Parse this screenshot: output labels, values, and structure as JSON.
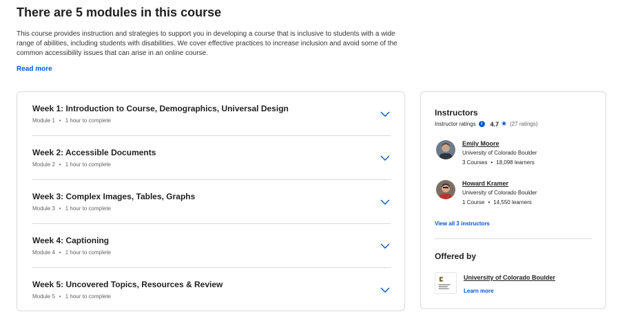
{
  "page": {
    "heading": "There are 5 modules in this course",
    "description": "This course provides instruction and strategies to support you in developing a course that is inclusive to students with a wide range of abilities, including students with disabilities. We cover effective practices to increase inclusion and avoid some of the common accessibility issues that can arise in an online course.",
    "read_more": "Read more"
  },
  "modules": [
    {
      "title": "Week 1: Introduction to Course, Demographics, Universal Design",
      "module": "Module 1",
      "duration": "1 hour to complete"
    },
    {
      "title": "Week 2: Accessible Documents",
      "module": "Module 2",
      "duration": "1 hour to complete"
    },
    {
      "title": "Week 3: Complex Images, Tables, Graphs",
      "module": "Module 3",
      "duration": "1 hour to complete"
    },
    {
      "title": "Week 4: Captioning",
      "module": "Module 4",
      "duration": "1 hour to complete"
    },
    {
      "title": "Week 5: Uncovered Topics, Resources & Review",
      "module": "Module 5",
      "duration": "1 hour to complete"
    }
  ],
  "instructors": {
    "title": "Instructors",
    "ratings_label": "Instructor ratings",
    "rating": "4.7",
    "ratings_count": "(27 ratings)",
    "list": [
      {
        "name": "Emily Moore",
        "org": "University of Colorado Boulder",
        "courses": "3 Courses",
        "learners": "18,098 learners"
      },
      {
        "name": "Howard Kramer",
        "org": "University of Colorado Boulder",
        "courses": "1 Course",
        "learners": "14,550 learners"
      }
    ],
    "view_all": "View all 3 instructors"
  },
  "offered_by": {
    "title": "Offered by",
    "org_name": "University of Colorado Boulder",
    "learn_more": "Learn more"
  },
  "colors": {
    "accent": "#0056d2",
    "text": "#1f1f1f",
    "muted": "#636363",
    "border": "#dadada"
  }
}
